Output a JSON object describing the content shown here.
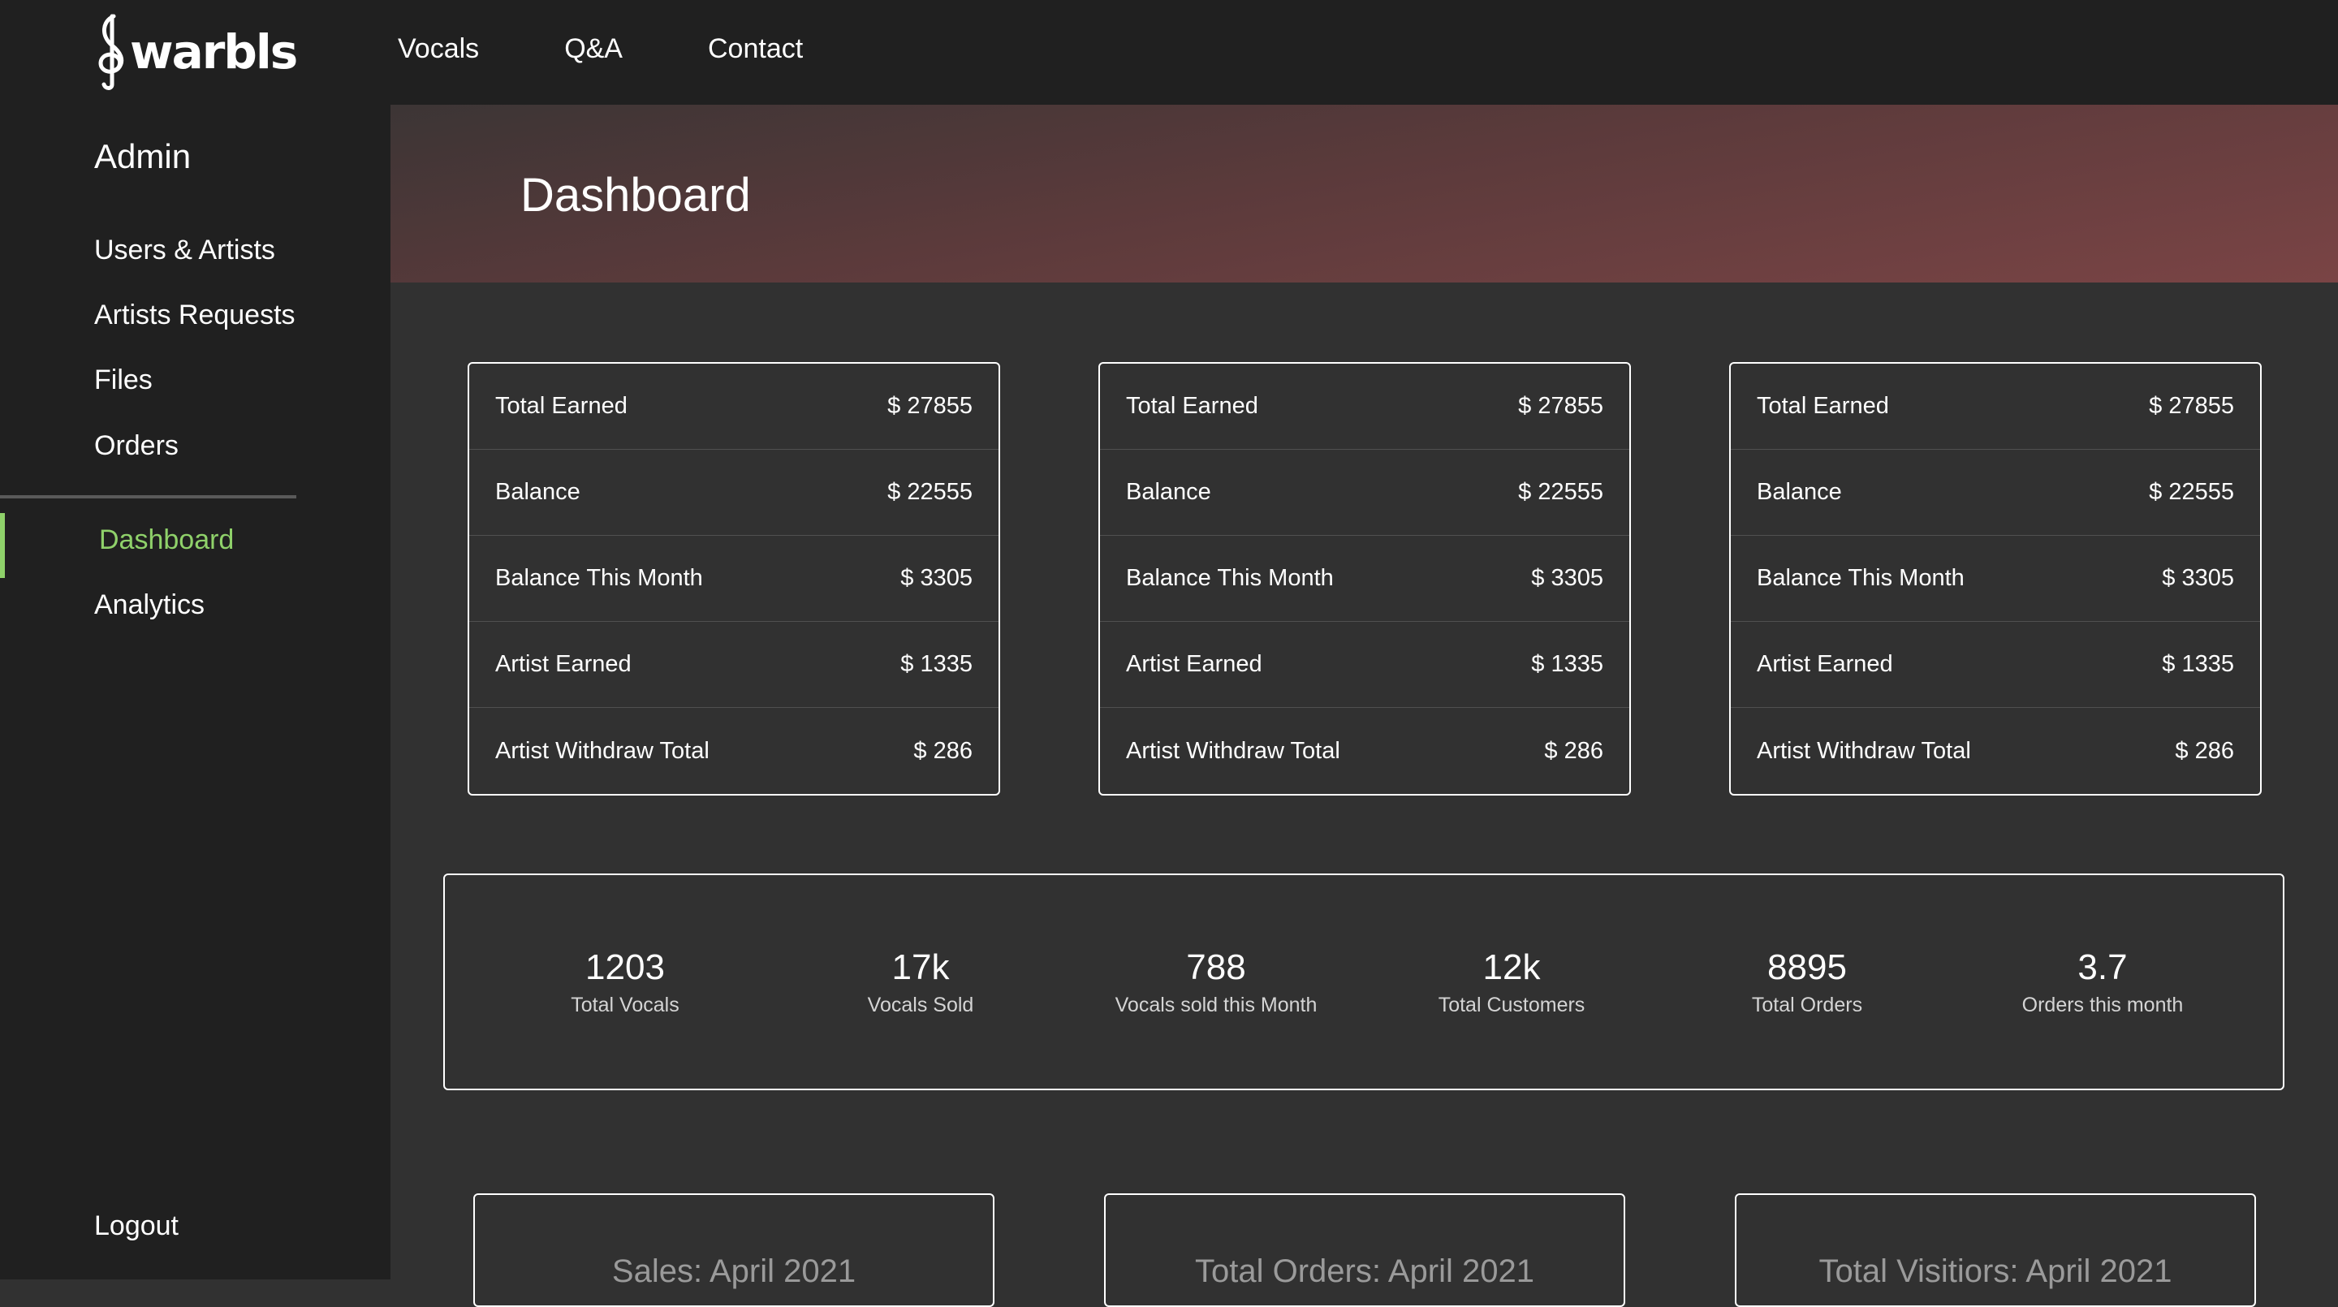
{
  "brand": {
    "logo_text": "warbls"
  },
  "topnav": {
    "items": [
      "Vocals",
      "Q&A",
      "Contact"
    ]
  },
  "sidebar": {
    "title": "Admin",
    "items": [
      "Users & Artists",
      "Artists Requests",
      "Files",
      "Orders"
    ],
    "section2": [
      "Dashboard",
      "Analytics"
    ],
    "active": "Dashboard",
    "logout": "Logout",
    "accent_color": "#8fd16a"
  },
  "page": {
    "title": "Dashboard"
  },
  "stat_tables": [
    {
      "rows": [
        {
          "label": "Total Earned",
          "value": "$ 27855"
        },
        {
          "label": "Balance",
          "value": "$ 22555"
        },
        {
          "label": "Balance This Month",
          "value": "$ 3305"
        },
        {
          "label": "Artist Earned",
          "value": "$ 1335"
        },
        {
          "label": "Artist Withdraw Total",
          "value": "$ 286"
        }
      ]
    },
    {
      "rows": [
        {
          "label": "Total Earned",
          "value": "$ 27855"
        },
        {
          "label": "Balance",
          "value": "$ 22555"
        },
        {
          "label": "Balance This Month",
          "value": "$ 3305"
        },
        {
          "label": "Artist Earned",
          "value": "$ 1335"
        },
        {
          "label": "Artist Withdraw Total",
          "value": "$ 286"
        }
      ]
    },
    {
      "rows": [
        {
          "label": "Total Earned",
          "value": "$ 27855"
        },
        {
          "label": "Balance",
          "value": "$ 22555"
        },
        {
          "label": "Balance This Month",
          "value": "$ 3305"
        },
        {
          "label": "Artist Earned",
          "value": "$ 1335"
        },
        {
          "label": "Artist Withdraw Total",
          "value": "$ 286"
        }
      ]
    }
  ],
  "metrics": [
    {
      "value": "1203",
      "label": "Total Vocals"
    },
    {
      "value": "17k",
      "label": "Vocals Sold"
    },
    {
      "value": "788",
      "label": "Vocals sold this Month"
    },
    {
      "value": "12k",
      "label": "Total Customers"
    },
    {
      "value": "8895",
      "label": "Total Orders"
    },
    {
      "value": "3.7",
      "label": "Orders this month"
    }
  ],
  "reports": [
    {
      "title": "Sales: April 2021"
    },
    {
      "title": "Total Orders: April 2021"
    },
    {
      "title": "Total Visitiors: April 2021"
    }
  ]
}
